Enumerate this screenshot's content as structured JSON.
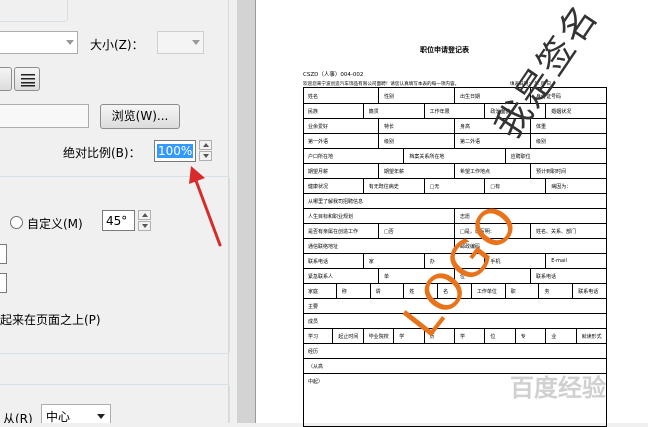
{
  "dialog": {
    "size_label": "大小(Z)：",
    "browse_button": "浏览(W)...",
    "scale_label": "绝对比例(B)：",
    "scale_value": "100%",
    "custom_label": "自定义(M)",
    "angle_value": "45°",
    "on_top_label": "起来在页面之上(P)",
    "from_label": "从(R)",
    "from_value": "中心"
  },
  "document": {
    "title": "职位申请登记表",
    "code": "CSZD（人事）004-002",
    "intro": "欢迎您来宁波创造汽车饰品有限公司面聘！请您认真填写本表的每一项内容。",
    "date_tail": "填表日期：       年    月    日",
    "rows": [
      [
        "姓名",
        "性别",
        "出生日期",
        "身份证号码"
      ],
      [
        "民族",
        "籍贯",
        "工作年限",
        "政治面貌",
        "婚姻状况"
      ],
      [
        "业余爱好",
        "特长",
        "身高",
        "体重"
      ],
      [
        "第一外语",
        "级别",
        "第二外语",
        "级别"
      ],
      [
        "户口所在地",
        "档案关系所在地",
        "应聘职位"
      ],
      [
        "期望月薪",
        "期望年薪",
        "希望工作地点",
        "预计到职时间"
      ],
      [
        "健康状况",
        "有无既往病史",
        "□无",
        "□有",
        "病因为："
      ],
      [
        "从哪里了解我司招聘信息"
      ],
      [
        "人生目标和职业规划",
        "志愿"
      ],
      [
        "是否有亲属在创造工作",
        "□否",
        "□是，请写明：",
        "姓名、关系、部门"
      ],
      [
        "通信联络地址",
        "邮政编码"
      ],
      [
        "联系电话",
        "家",
        "办",
        "手机",
        "E-mail"
      ],
      [
        "紧急联系人",
        "单",
        "位",
        "联系电话"
      ],
      [
        "家庭",
        "称",
        "谓",
        "姓",
        "名",
        "工作单位",
        "职",
        "务",
        "联系电话"
      ],
      [
        "主要"
      ],
      [
        "成员"
      ],
      [
        "学习",
        "起止时间",
        "毕业院校",
        "学",
        "历",
        "学",
        "位",
        "专",
        "业",
        "就读形式"
      ],
      [
        "经历"
      ],
      [
        "（从高"
      ],
      [
        "中起）"
      ]
    ]
  },
  "watermarks": {
    "logo_text": "LOGO",
    "signature_text": "我是签名",
    "corner_mark": "百度经验"
  },
  "colors": {
    "arrow": "#d82c2c",
    "logo": "#e8731a",
    "selection": "#3399ff"
  }
}
